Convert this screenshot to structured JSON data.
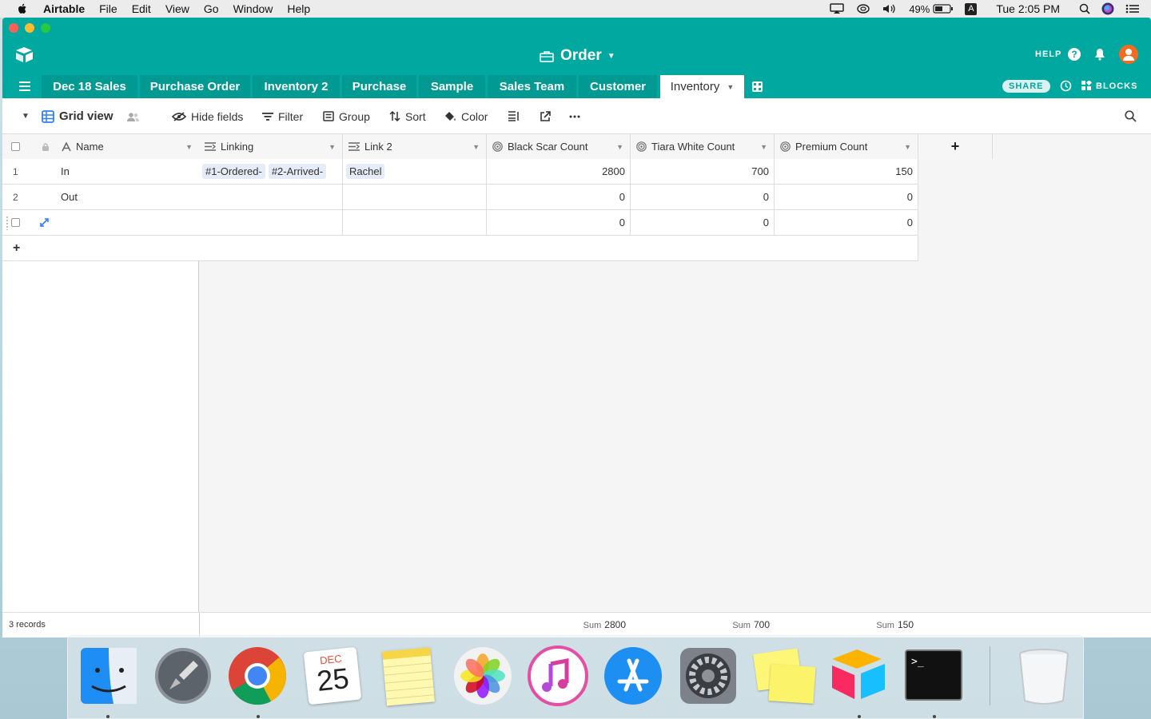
{
  "menubar": {
    "app": "Airtable",
    "items": [
      "File",
      "Edit",
      "View",
      "Go",
      "Window",
      "Help"
    ],
    "battery": "49%",
    "input_source": "A",
    "clock": "Tue 2:05 PM"
  },
  "base": {
    "title": "Order",
    "help": "HELP",
    "share": "SHARE",
    "blocks": "BLOCKS"
  },
  "tabs": [
    {
      "label": "Dec 18 Sales"
    },
    {
      "label": "Purchase Order"
    },
    {
      "label": "Inventory 2"
    },
    {
      "label": "Purchase"
    },
    {
      "label": "Sample"
    },
    {
      "label": "Sales Team"
    },
    {
      "label": "Customer"
    },
    {
      "label": "Inventory",
      "active": true
    }
  ],
  "toolbar": {
    "view_name": "Grid view",
    "hide_fields": "Hide fields",
    "filter": "Filter",
    "group": "Group",
    "sort": "Sort",
    "color": "Color"
  },
  "columns": {
    "name": "Name",
    "linking": "Linking",
    "link2": "Link 2",
    "black_scar": "Black Scar Count",
    "tiara_white": "Tiara White Count",
    "premium": "Premium Count",
    "add": "+"
  },
  "rows": [
    {
      "num": "1",
      "name": "In",
      "linking": [
        "#1-Ordered-",
        "#2-Arrived-"
      ],
      "link2": [
        "Rachel"
      ],
      "black_scar": "2800",
      "tiara_white": "700",
      "premium": "150"
    },
    {
      "num": "2",
      "name": "Out",
      "linking": [],
      "link2": [],
      "black_scar": "0",
      "tiara_white": "0",
      "premium": "0"
    },
    {
      "num": "",
      "name": "",
      "linking": [],
      "link2": [],
      "black_scar": "0",
      "tiara_white": "0",
      "premium": "0"
    }
  ],
  "add_row": "+",
  "footer": {
    "records": "3 records",
    "sum_label": "Sum",
    "sum_black_scar": "2800",
    "sum_tiara_white": "700",
    "sum_premium": "150"
  },
  "dock": {
    "calendar_month": "DEC",
    "calendar_day": "25",
    "apps": [
      "finder-icon",
      "launchpad-icon",
      "chrome-icon",
      "calendar-icon",
      "notes-icon",
      "photos-icon",
      "itunes-icon",
      "app-store-icon",
      "system-preferences-icon",
      "stickies-icon",
      "airtable-icon",
      "terminal-icon",
      "trash-icon"
    ]
  },
  "colors": {
    "brand": "#00a8a0",
    "active_tab": "#ffffff",
    "link_chip": "#e5ecf7"
  }
}
